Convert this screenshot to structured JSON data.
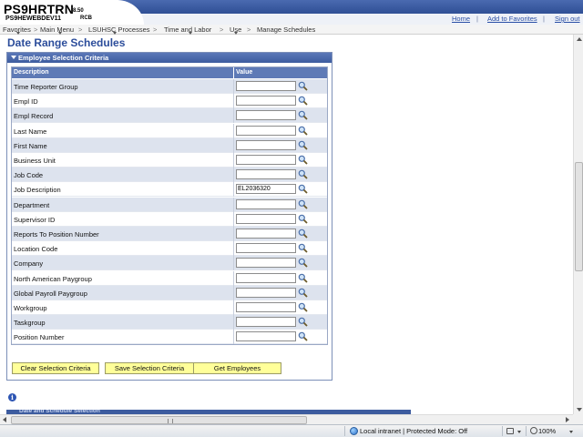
{
  "header": {
    "app_title": "PS9HRTRN",
    "app_version": "8.50",
    "database": "PS9HEWEBDEV11",
    "user": "RCB",
    "links": [
      "Home",
      "Add to Favorites",
      "Sign out"
    ]
  },
  "breadcrumb": [
    "Favorites",
    "Main Menu",
    "LSUHSC Processes",
    "Time and Labor",
    "Use",
    "Manage Schedules"
  ],
  "page_title": "Date Range Schedules",
  "section": {
    "title": "Employee Selection Criteria",
    "columns": [
      "Description",
      "Value"
    ],
    "rows": [
      {
        "label": "Time Reporter Group",
        "value": ""
      },
      {
        "label": "Empl ID",
        "value": ""
      },
      {
        "label": "Empl Record",
        "value": ""
      },
      {
        "label": "Last Name",
        "value": ""
      },
      {
        "label": "First Name",
        "value": ""
      },
      {
        "label": "Business Unit",
        "value": ""
      },
      {
        "label": "Job Code",
        "value": ""
      },
      {
        "label": "Job Description",
        "value": "EL2036320"
      },
      {
        "label": "Department",
        "value": ""
      },
      {
        "label": "Supervisor ID",
        "value": ""
      },
      {
        "label": "Reports To Position Number",
        "value": ""
      },
      {
        "label": "Location Code",
        "value": ""
      },
      {
        "label": "Company",
        "value": ""
      },
      {
        "label": "North American Paygroup",
        "value": ""
      },
      {
        "label": "Global Payroll Paygroup",
        "value": ""
      },
      {
        "label": "Workgroup",
        "value": ""
      },
      {
        "label": "Taskgroup",
        "value": ""
      },
      {
        "label": "Position Number",
        "value": ""
      }
    ],
    "buttons": {
      "clear": "Clear Selection Criteria",
      "save": "Save Selection Criteria",
      "get": "Get Employees"
    }
  },
  "lower_section_title": "Date and Schedule Selection",
  "statusbar": {
    "zone": "Local intranet | Protected Mode: Off",
    "zoom": "100%"
  },
  "icons": {
    "lookup": "magnifier-icon",
    "info": "info-icon",
    "globe": "globe-icon"
  },
  "colors": {
    "title": "#2c4d9b",
    "section_header": "#3d5c9f",
    "grid_header": "#5e7ab6",
    "row_alt": "#dde3ee",
    "button": "#ffff99"
  }
}
